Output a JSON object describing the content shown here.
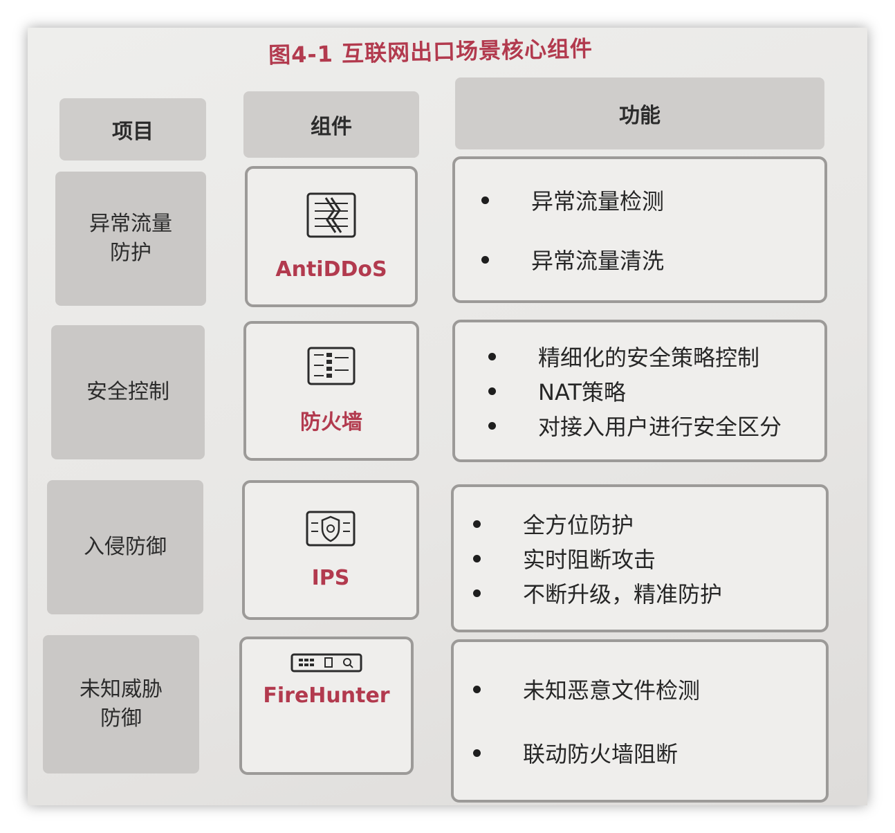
{
  "title": "图4-1 互联网出口场景核心组件",
  "headers": {
    "item": "项目",
    "component": "组件",
    "function": "功能"
  },
  "rows": [
    {
      "item": "异常流量\n防护",
      "component": "AntiDDoS",
      "icon": "antiddos-device-icon",
      "functions": [
        "异常流量检测",
        "异常流量清洗"
      ]
    },
    {
      "item": "安全控制",
      "component": "防火墙",
      "icon": "firewall-device-icon",
      "functions": [
        "精细化的安全策略控制",
        "NAT策略",
        "对接入用户进行安全区分"
      ]
    },
    {
      "item": "入侵防御",
      "component": "IPS",
      "icon": "ips-shield-icon",
      "functions": [
        "全方位防护",
        "实时阻断攻击",
        "不断升级，精准防护"
      ]
    },
    {
      "item": "未知威胁\n防御",
      "component": "FireHunter",
      "icon": "firehunter-device-icon",
      "functions": [
        "未知恶意文件检测",
        "联动防火墙阻断"
      ]
    }
  ],
  "colors": {
    "accent": "#b23a4e",
    "header_bg": "#cfcdcb",
    "item_bg": "#cac8c6",
    "border": "#9c9a98"
  }
}
